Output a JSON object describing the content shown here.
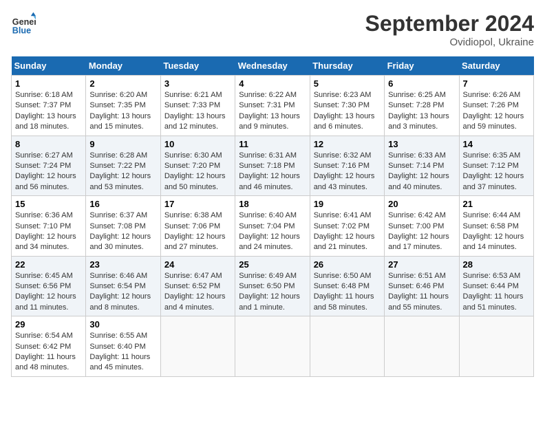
{
  "header": {
    "logo_line1": "General",
    "logo_line2": "Blue",
    "month": "September 2024",
    "location": "Ovidiopol, Ukraine"
  },
  "days_of_week": [
    "Sunday",
    "Monday",
    "Tuesday",
    "Wednesday",
    "Thursday",
    "Friday",
    "Saturday"
  ],
  "weeks": [
    [
      {
        "day": 1,
        "sunrise": "6:18 AM",
        "sunset": "7:37 PM",
        "daylight": "13 hours and 18 minutes."
      },
      {
        "day": 2,
        "sunrise": "6:20 AM",
        "sunset": "7:35 PM",
        "daylight": "13 hours and 15 minutes."
      },
      {
        "day": 3,
        "sunrise": "6:21 AM",
        "sunset": "7:33 PM",
        "daylight": "13 hours and 12 minutes."
      },
      {
        "day": 4,
        "sunrise": "6:22 AM",
        "sunset": "7:31 PM",
        "daylight": "13 hours and 9 minutes."
      },
      {
        "day": 5,
        "sunrise": "6:23 AM",
        "sunset": "7:30 PM",
        "daylight": "13 hours and 6 minutes."
      },
      {
        "day": 6,
        "sunrise": "6:25 AM",
        "sunset": "7:28 PM",
        "daylight": "13 hours and 3 minutes."
      },
      {
        "day": 7,
        "sunrise": "6:26 AM",
        "sunset": "7:26 PM",
        "daylight": "12 hours and 59 minutes."
      }
    ],
    [
      {
        "day": 8,
        "sunrise": "6:27 AM",
        "sunset": "7:24 PM",
        "daylight": "12 hours and 56 minutes."
      },
      {
        "day": 9,
        "sunrise": "6:28 AM",
        "sunset": "7:22 PM",
        "daylight": "12 hours and 53 minutes."
      },
      {
        "day": 10,
        "sunrise": "6:30 AM",
        "sunset": "7:20 PM",
        "daylight": "12 hours and 50 minutes."
      },
      {
        "day": 11,
        "sunrise": "6:31 AM",
        "sunset": "7:18 PM",
        "daylight": "12 hours and 46 minutes."
      },
      {
        "day": 12,
        "sunrise": "6:32 AM",
        "sunset": "7:16 PM",
        "daylight": "12 hours and 43 minutes."
      },
      {
        "day": 13,
        "sunrise": "6:33 AM",
        "sunset": "7:14 PM",
        "daylight": "12 hours and 40 minutes."
      },
      {
        "day": 14,
        "sunrise": "6:35 AM",
        "sunset": "7:12 PM",
        "daylight": "12 hours and 37 minutes."
      }
    ],
    [
      {
        "day": 15,
        "sunrise": "6:36 AM",
        "sunset": "7:10 PM",
        "daylight": "12 hours and 34 minutes."
      },
      {
        "day": 16,
        "sunrise": "6:37 AM",
        "sunset": "7:08 PM",
        "daylight": "12 hours and 30 minutes."
      },
      {
        "day": 17,
        "sunrise": "6:38 AM",
        "sunset": "7:06 PM",
        "daylight": "12 hours and 27 minutes."
      },
      {
        "day": 18,
        "sunrise": "6:40 AM",
        "sunset": "7:04 PM",
        "daylight": "12 hours and 24 minutes."
      },
      {
        "day": 19,
        "sunrise": "6:41 AM",
        "sunset": "7:02 PM",
        "daylight": "12 hours and 21 minutes."
      },
      {
        "day": 20,
        "sunrise": "6:42 AM",
        "sunset": "7:00 PM",
        "daylight": "12 hours and 17 minutes."
      },
      {
        "day": 21,
        "sunrise": "6:44 AM",
        "sunset": "6:58 PM",
        "daylight": "12 hours and 14 minutes."
      }
    ],
    [
      {
        "day": 22,
        "sunrise": "6:45 AM",
        "sunset": "6:56 PM",
        "daylight": "12 hours and 11 minutes."
      },
      {
        "day": 23,
        "sunrise": "6:46 AM",
        "sunset": "6:54 PM",
        "daylight": "12 hours and 8 minutes."
      },
      {
        "day": 24,
        "sunrise": "6:47 AM",
        "sunset": "6:52 PM",
        "daylight": "12 hours and 4 minutes."
      },
      {
        "day": 25,
        "sunrise": "6:49 AM",
        "sunset": "6:50 PM",
        "daylight": "12 hours and 1 minute."
      },
      {
        "day": 26,
        "sunrise": "6:50 AM",
        "sunset": "6:48 PM",
        "daylight": "11 hours and 58 minutes."
      },
      {
        "day": 27,
        "sunrise": "6:51 AM",
        "sunset": "6:46 PM",
        "daylight": "11 hours and 55 minutes."
      },
      {
        "day": 28,
        "sunrise": "6:53 AM",
        "sunset": "6:44 PM",
        "daylight": "11 hours and 51 minutes."
      }
    ],
    [
      {
        "day": 29,
        "sunrise": "6:54 AM",
        "sunset": "6:42 PM",
        "daylight": "11 hours and 48 minutes."
      },
      {
        "day": 30,
        "sunrise": "6:55 AM",
        "sunset": "6:40 PM",
        "daylight": "11 hours and 45 minutes."
      },
      null,
      null,
      null,
      null,
      null
    ]
  ]
}
